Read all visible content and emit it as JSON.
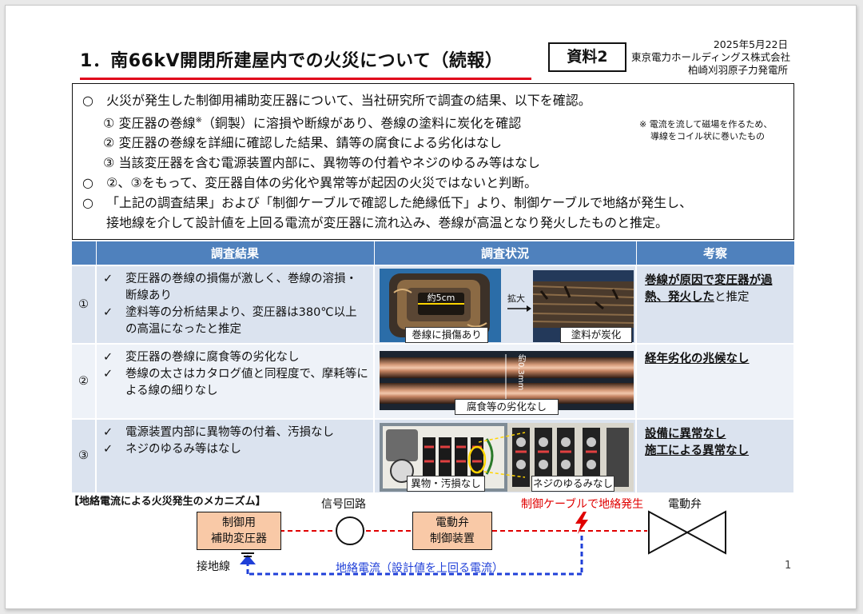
{
  "header": {
    "title": "1．南66kV開閉所建屋内での火災について（続報）",
    "doc_label": "資料2",
    "date": "2025年5月22日",
    "company": "東京電力ホールディングス株式会社",
    "plant": "柏崎刈羽原子力発電所"
  },
  "summary": {
    "bullet": "○",
    "p1": "火災が発生した制御用補助変圧器について、当社研究所で調査の結果、以下を確認。",
    "i1_num": "①",
    "i1_a": "変圧器の巻線",
    "i1_note": "※",
    "i1_b": "（銅製）に溶損や断線があり、巻線の塗料に炭化を確認",
    "i2_num": "②",
    "i2": "変圧器の巻線を詳細に確認した結果、錆等の腐食による劣化はなし",
    "i3_num": "③",
    "i3": "当該変圧器を含む電源装置内部に、異物等の付着やネジのゆるみ等はなし",
    "p2": "②、③をもって、変圧器自体の劣化や異常等が起因の火災ではないと判断。",
    "p3_line1": "「上記の調査結果」および「制御ケーブルで確認した絶縁低下」より、制御ケーブルで地絡が発生し、",
    "p3_line2": "接地線を介して設計値を上回る電流が変圧器に流れ込み、巻線が高温となり発火したものと推定。",
    "footnote_line1": "※ 電流を流して磁場を作るため、",
    "footnote_line2": "導線をコイル状に巻いたもの"
  },
  "table": {
    "headers": [
      "調査結果",
      "調査状況",
      "考察"
    ],
    "check": "✓",
    "rows": [
      {
        "num": "①",
        "results": [
          "変圧器の巻線の損傷が激しく、巻線の溶損・断線あり",
          "塗料等の分析結果より、変圧器は380℃以上の高温になったと推定"
        ],
        "photo_dim": "約5cm",
        "photo_arrow": "拡大",
        "caption_left": "巻線に損傷あり",
        "caption_right": "塗料が炭化",
        "obs_emph": "巻線が原因で変圧器が過熱、発火した",
        "obs_rest": "と推定"
      },
      {
        "num": "②",
        "results": [
          "変圧器の巻線に腐食等の劣化なし",
          "巻線の太さはカタログ値と同程度で、摩耗等による線の細りなし"
        ],
        "photo_dim": "約0.3mm",
        "caption": "腐食等の劣化なし",
        "obs_emph": "経年劣化の兆候なし"
      },
      {
        "num": "③",
        "results": [
          "電源装置内部に異物等の付着、汚損なし",
          "ネジのゆるみ等はなし"
        ],
        "caption_left": "異物・汚損なし",
        "caption_right": "ネジのゆるみなし",
        "obs_emph1": "設備に異常なし",
        "obs_emph2": "施工による異常なし"
      }
    ]
  },
  "mechanism": {
    "title": "【地絡電流による火災発生のメカニズム】",
    "transformer_line1": "制御用",
    "transformer_line2": "補助変圧器",
    "signal_circuit": "信号回路",
    "valve_ctrl_line1": "電動弁",
    "valve_ctrl_line2": "制御装置",
    "ground_fault": "制御ケーブルで地絡発生",
    "valve": "電動弁",
    "ground_wire": "接地線",
    "fault_current": "地絡電流（設計値を上回る電流）"
  },
  "page_number": "1",
  "colors": {
    "header_blue": "#4f81bd",
    "accent_red": "#e0001a",
    "box_orange": "#f9c9a7",
    "current_blue": "#1f3fd8"
  }
}
